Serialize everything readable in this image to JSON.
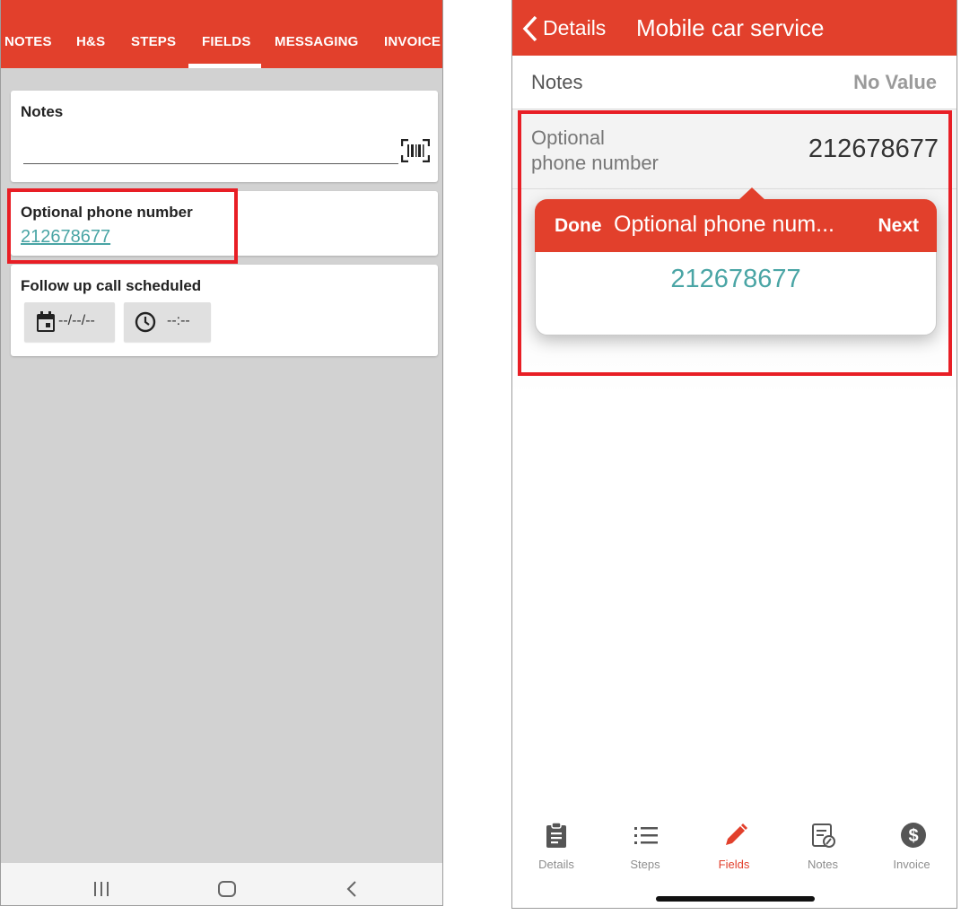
{
  "colors": {
    "brand_red": "#e2402c",
    "teal_value": "#4aa5a5",
    "highlight_red": "#e81e25"
  },
  "android": {
    "tabs": [
      {
        "label": "NOTES"
      },
      {
        "label": "H&S"
      },
      {
        "label": "STEPS"
      },
      {
        "label": "FIELDS",
        "active": true
      },
      {
        "label": "MESSAGING"
      },
      {
        "label": "INVOICE"
      }
    ],
    "notes_card": {
      "title": "Notes",
      "value": "",
      "scan_icon": "barcode-scan-icon"
    },
    "phone_card": {
      "title": "Optional phone number",
      "value": "212678677"
    },
    "followup_card": {
      "title": "Follow up call scheduled",
      "date_placeholder": "--/--/--",
      "time_placeholder": "--:--"
    },
    "navbar": {
      "icons": [
        "recent-apps-icon",
        "home-icon",
        "back-icon"
      ]
    }
  },
  "ios": {
    "nav": {
      "back_label": "Details",
      "title": "Mobile car service"
    },
    "rows": [
      {
        "label": "Notes",
        "value": "No Value"
      },
      {
        "label_line1": "Optional",
        "label_line2": "phone number",
        "value": "212678677"
      }
    ],
    "popover": {
      "done": "Done",
      "title": "Optional phone num...",
      "next": "Next",
      "value": "212678677"
    },
    "tabbar": [
      {
        "label": "Details",
        "icon": "clipboard-icon"
      },
      {
        "label": "Steps",
        "icon": "list-icon"
      },
      {
        "label": "Fields",
        "icon": "pencil-icon",
        "active": true
      },
      {
        "label": "Notes",
        "icon": "notes-icon"
      },
      {
        "label": "Invoice",
        "icon": "dollar-icon"
      }
    ]
  }
}
